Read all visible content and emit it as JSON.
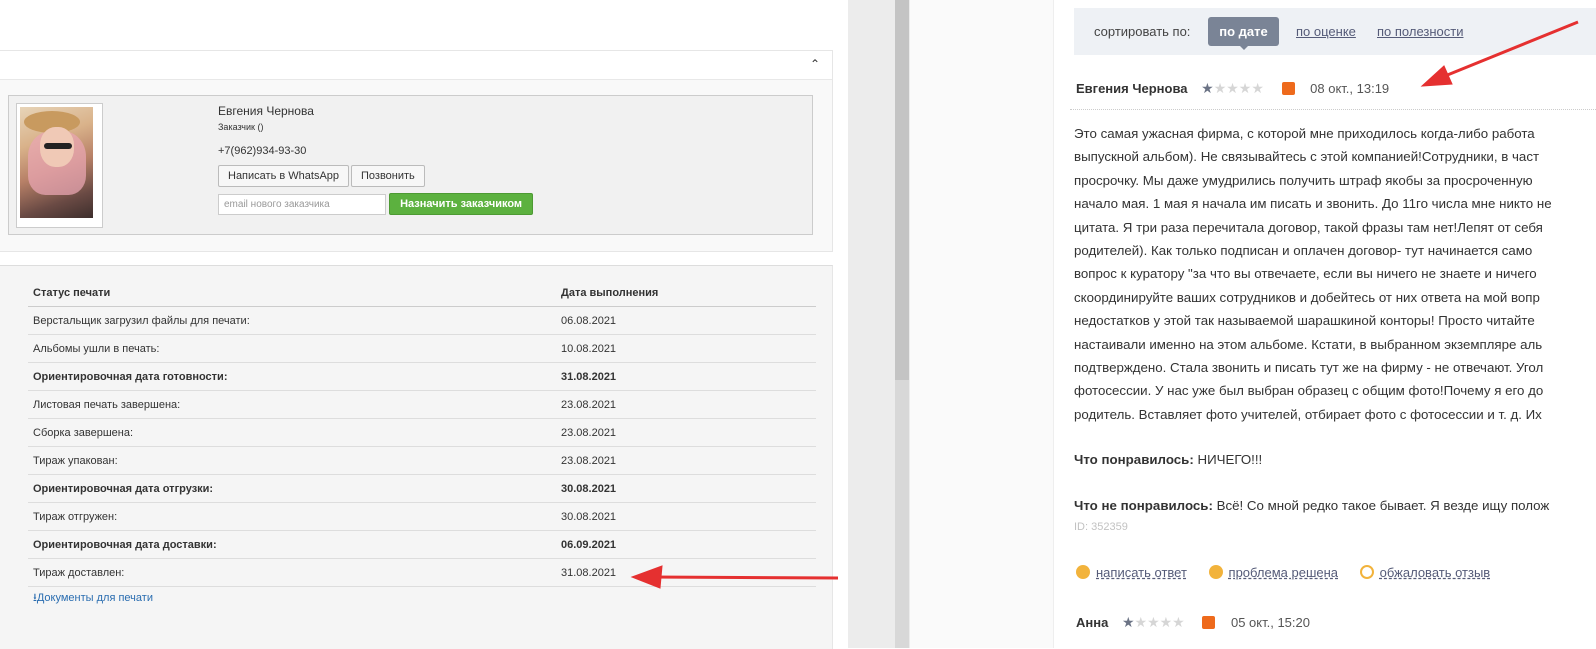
{
  "left": {
    "customer": {
      "name": "Евгения Чернова",
      "role": "Заказчик ()",
      "phone": "+7(962)934-93-30",
      "whatsapp_button": "Написать в WhatsApp",
      "call_button": "Позвонить",
      "email_placeholder": "email нового заказчика",
      "assign_button": "Назначить заказчиком"
    },
    "status_table": {
      "headers": [
        "Статус печати",
        "Дата выполнения"
      ],
      "rows": [
        {
          "status": "Верстальщик загрузил файлы для печати:",
          "date": "06.08.2021"
        },
        {
          "status": "Альбомы ушли в печать:",
          "date": "10.08.2021"
        },
        {
          "status": "Ориентировочная дата готовности:",
          "date": "31.08.2021"
        },
        {
          "status": "Листовая печать завершена:",
          "date": "23.08.2021"
        },
        {
          "status": "Сборка завершена:",
          "date": "23.08.2021"
        },
        {
          "status": "Тираж упакован:",
          "date": "23.08.2021"
        },
        {
          "status": "Ориентировочная дата отгрузки:",
          "date": "30.08.2021"
        },
        {
          "status": "Тираж отгружен:",
          "date": "30.08.2021"
        },
        {
          "status": "Ориентировочная дата доставки:",
          "date": "06.09.2021"
        },
        {
          "status": "Тираж доставлен:",
          "date": "31.08.2021"
        }
      ]
    },
    "docs_link": "Документы для печати"
  },
  "right": {
    "sort": {
      "label": "сортировать по:",
      "active": "по дате",
      "by_rating": "по оценке",
      "by_usefulness": "по полезности"
    },
    "review": {
      "author": "Евгения Чернова",
      "rating": 1,
      "date": "08 окт., 13:19",
      "lines": [
        "Это самая ужасная фирма, с которой мне приходилось когда-либо работа",
        "выпускной альбом). Не связывайтесь с этой компанией!Сотрудники, в част",
        "просрочку. Мы даже умудрились получить штраф якобы за просроченную",
        "начало мая. 1 мая я начала им писать и звонить. До 11го числа мне никто не",
        "цитата. Я три раза перечитала договор, такой фразы там нет!Лепят от себя",
        "родителей). Как только подписан и оплачен договор- тут начинается само",
        "вопрос к куратору \"за что вы отвечаете, если вы ничего не знаете и ничего",
        "скоординируйте ваших сотрудников и добейтесь от них ответа на мой вопр",
        "недостатков у этой так называемой шарашкиной конторы! Просто читайте",
        "настаивали именно на этом альбоме. Кстати, в выбранном экземпляре аль",
        "подтверждено. Стала звонить и писать тут же на фирму - не отвечают. Угол",
        "фотосессии. У нас уже был выбран образец с общим фото!Почему я его до",
        "родитель. Вставляет фото учителей, отбирает фото с фотосессии и т. д. Их"
      ],
      "liked_label": "Что понравилось:",
      "liked_text": "НИЧЕГО!!!",
      "disliked_label": "Что не понравилось:",
      "disliked_text": "Всё! Со мной редко такое бывает. Я везде ищу полож",
      "id": "ID: 352359",
      "actions": {
        "reply": "написать ответ",
        "resolved": "проблема решена",
        "complain": "обжаловать отзыв"
      }
    },
    "review2": {
      "author": "Анна",
      "rating": 1,
      "date": "05 окт., 15:20"
    }
  },
  "colors": {
    "arrow": "#e53030",
    "accent_green": "#5cb13f",
    "link_blue": "#2a6db0",
    "sort_active": "#7a8496",
    "thumb_down": "#ee6a1c"
  }
}
